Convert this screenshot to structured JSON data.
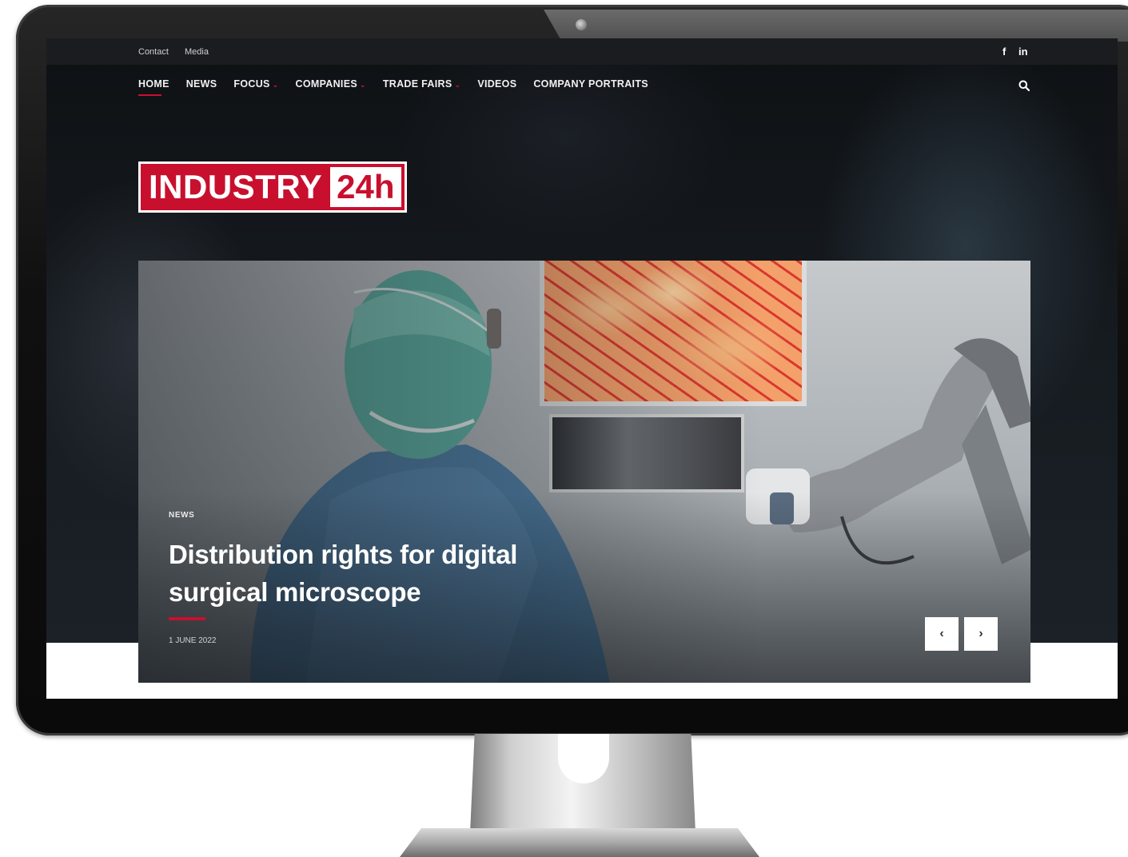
{
  "topbar": {
    "links": [
      "Contact",
      "Media"
    ],
    "social": [
      "f",
      "in"
    ]
  },
  "nav": {
    "items": [
      {
        "label": "HOME",
        "active": true,
        "dropdown": false
      },
      {
        "label": "NEWS",
        "active": false,
        "dropdown": false
      },
      {
        "label": "FOCUS",
        "active": false,
        "dropdown": true
      },
      {
        "label": "COMPANIES",
        "active": false,
        "dropdown": true
      },
      {
        "label": "TRADE FAIRS",
        "active": false,
        "dropdown": true
      },
      {
        "label": "VIDEOS",
        "active": false,
        "dropdown": false
      },
      {
        "label": "COMPANY PORTRAITS",
        "active": false,
        "dropdown": false
      }
    ],
    "caret": "⌄"
  },
  "logo": {
    "main": "INDUSTRY",
    "box": "24h"
  },
  "slide": {
    "category": "NEWS",
    "title": "Distribution rights for digital surgical microscope",
    "date": "1 JUNE 2022",
    "prev_label": "‹",
    "next_label": "›"
  },
  "colors": {
    "accent": "#c8102e",
    "topbar": "#1b1c1f"
  }
}
